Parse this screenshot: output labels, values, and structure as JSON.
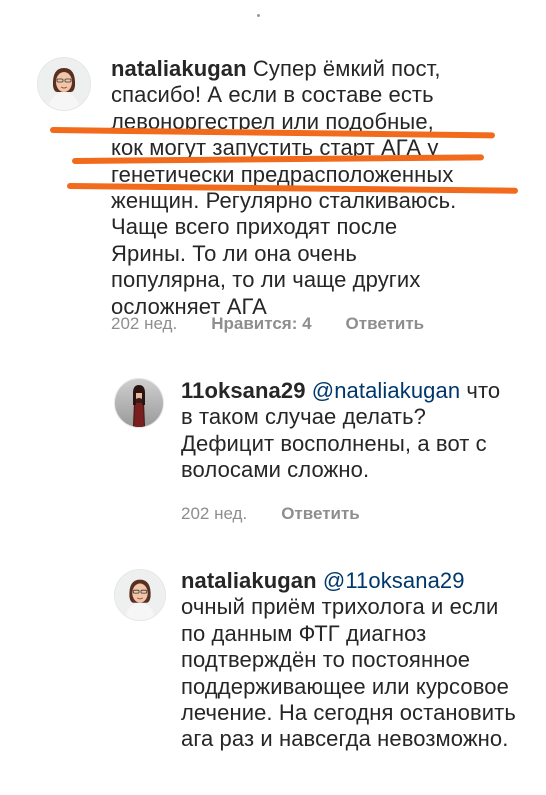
{
  "comments": [
    {
      "username": "nataliakugan",
      "mention": "",
      "text": "Супер ёмкий пост, спасибо! А если в составе есть левоноргестрел или подобные, кок могут запустить старт АГА у генетически предрасположенных женщин. Регулярно сталкиваюсь. Чаще всего приходят после Ярины. То ли она очень популярна, то ли чаще других осложняет АГА",
      "time": "202 нед.",
      "likes": "Нравится: 4",
      "reply": "Ответить"
    },
    {
      "username": "11oksana29",
      "mention": "@nataliakugan",
      "text": "что в таком случае делать? Дефицит восполнены, а вот с волосами сложно.",
      "time": "202 нед.",
      "likes": "",
      "reply": "Ответить"
    },
    {
      "username": "nataliakugan",
      "mention": "@11oksana29",
      "text": "очный приём трихолога и если по данным ФТГ диагноз подтверждён то постоянное поддерживающее или курсовое лечение. На сегодня остановить ага раз и навсегда невозможно.",
      "time": "",
      "likes": "",
      "reply": ""
    }
  ],
  "colors": {
    "highlight": "#f26a1b",
    "mention": "#00376b",
    "meta": "#8e8e8e"
  },
  "icons": [
    "avatar-nataliakugan",
    "avatar-11oksana29"
  ]
}
